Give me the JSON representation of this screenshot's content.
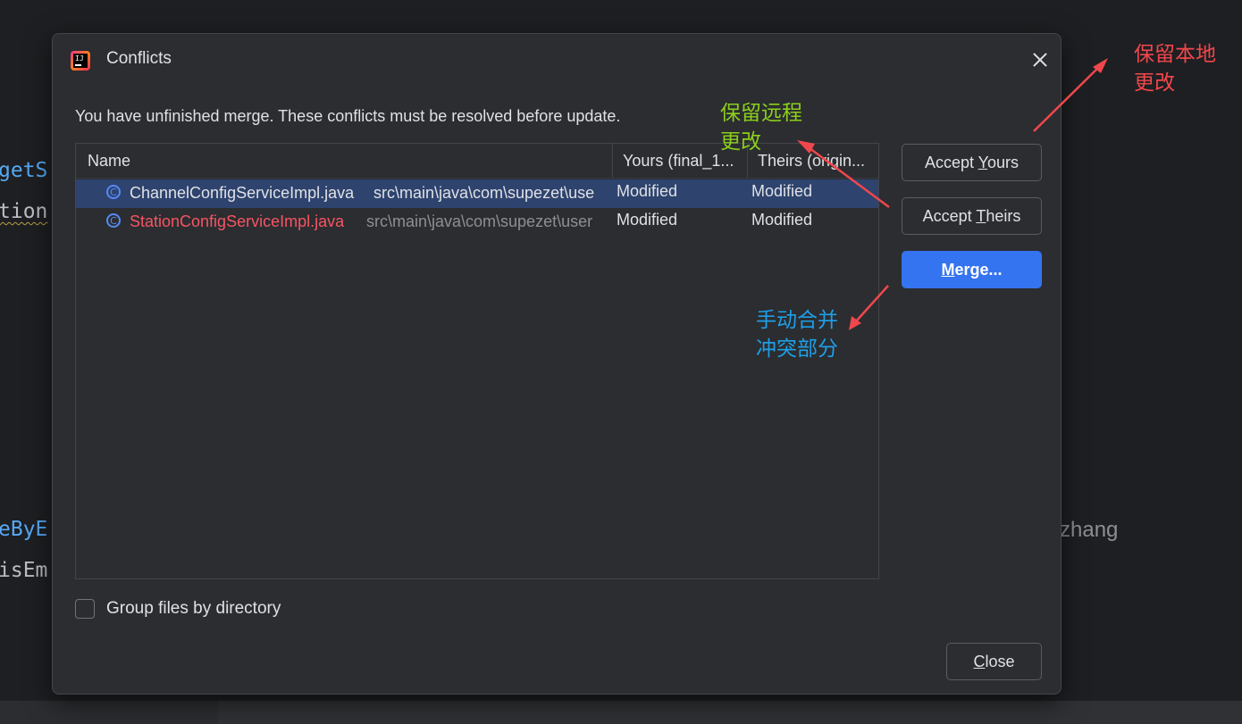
{
  "editor": {
    "code_lines": [
      "getS",
      "tion",
      "eByE",
      "isEm"
    ],
    "right_text": "zhang"
  },
  "dialog": {
    "title": "Conflicts",
    "message": "You have unfinished merge. These conflicts must be resolved before update.",
    "table": {
      "columns": [
        "Name",
        "Yours (final_1...",
        "Theirs (origin..."
      ],
      "rows": [
        {
          "file": "ChannelConfigServiceImpl.java",
          "path": "src\\main\\java\\com\\supezet\\use",
          "yours": "Modified",
          "theirs": "Modified",
          "selected": true
        },
        {
          "file": "StationConfigServiceImpl.java",
          "path": "src\\main\\java\\com\\supezet\\user",
          "yours": "Modified",
          "theirs": "Modified",
          "selected": false
        }
      ]
    },
    "buttons": {
      "accept_yours_pre": "Accept ",
      "accept_yours_mn": "Y",
      "accept_yours_post": "ours",
      "accept_theirs_pre": "Accept ",
      "accept_theirs_mn": "T",
      "accept_theirs_post": "heirs",
      "merge_mn": "M",
      "merge_post": "erge...",
      "close_mn": "C",
      "close_post": "lose"
    },
    "checkbox_label": "Group files by directory",
    "checkbox_checked": false
  },
  "annotations": {
    "keep_local": "保留本地\n更改",
    "keep_remote": "保留远程\n更改",
    "manual_merge": "手动合并\n冲突部分"
  },
  "colors": {
    "accent": "#3574f0",
    "selection": "#2e436e",
    "conflict_red": "#f75464",
    "annotation_red": "#f0474c",
    "annotation_green": "#8ccf1c",
    "annotation_blue": "#1e9fe8"
  }
}
